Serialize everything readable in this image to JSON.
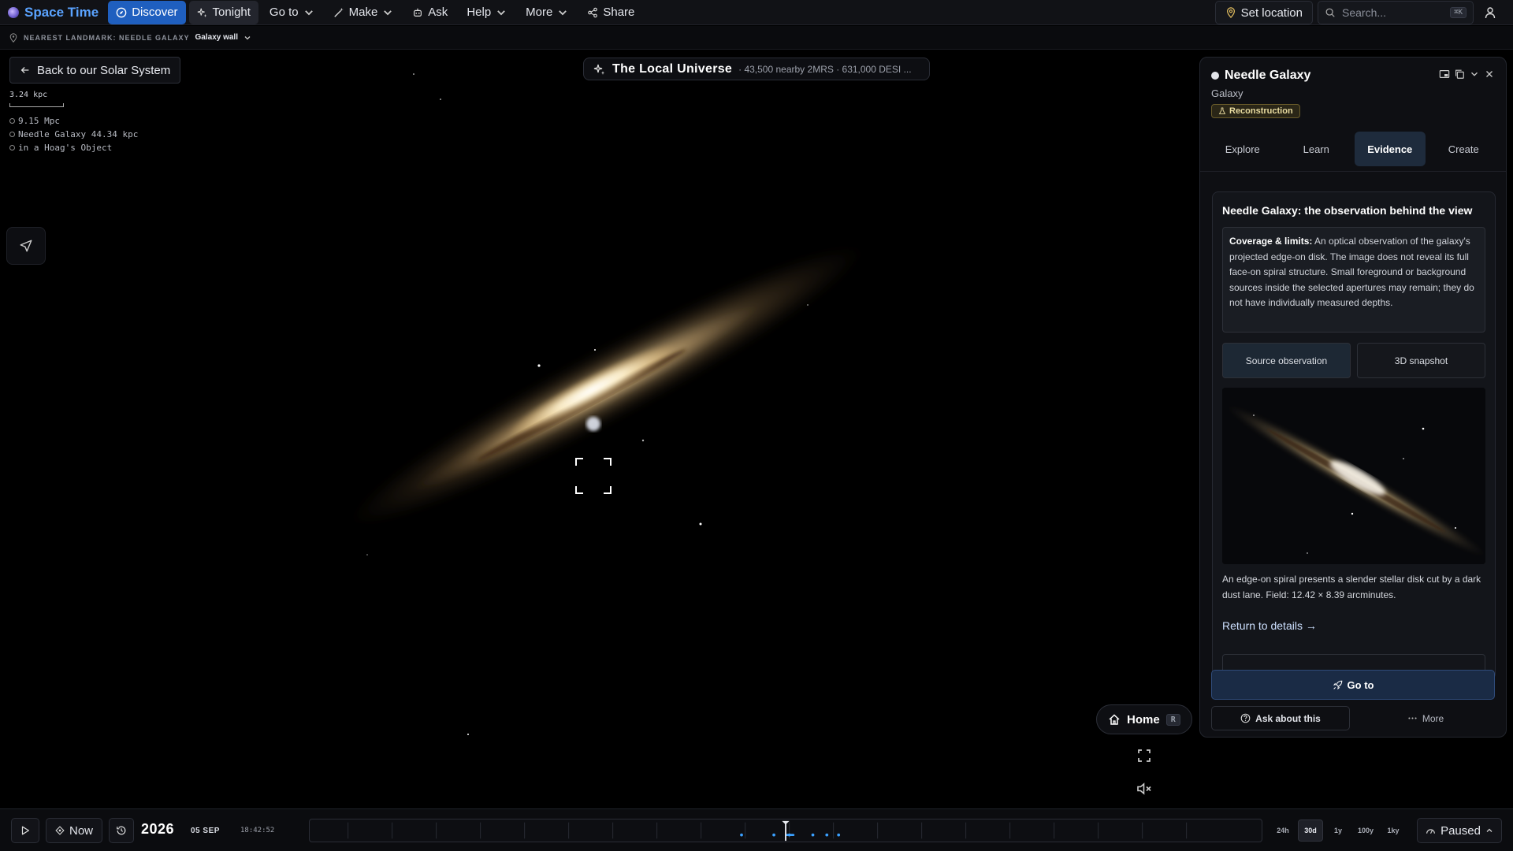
{
  "app": {
    "name": "Space Time"
  },
  "nav": {
    "discover": "Discover",
    "tonight": "Tonight",
    "goto": "Go to",
    "make": "Make",
    "ask": "Ask",
    "help": "Help",
    "more": "More",
    "share": "Share"
  },
  "top_right": {
    "set_location": "Set location",
    "search_placeholder": "Search...",
    "search_shortcut": "⌘K"
  },
  "subbar": {
    "landmark_label": "NEAREST LANDMARK: NEEDLE GALAXY",
    "landmark_value": "Galaxy wall"
  },
  "overlay": {
    "back_label": "Back to our Solar System",
    "scale_label": "3.24 kpc",
    "distances": [
      "9.15 Mpc",
      "Needle Galaxy 44.34 kpc",
      "in a Hoag's Object"
    ]
  },
  "universe": {
    "title": "The Local Universe",
    "subtitle": "· 43,500 nearby 2MRS · 631,000 DESI ..."
  },
  "controls": {
    "home_label": "Home",
    "home_key": "R"
  },
  "panel": {
    "title": "Needle Galaxy",
    "type": "Galaxy",
    "badge": "Reconstruction",
    "tabs": [
      "Explore",
      "Learn",
      "Evidence",
      "Create"
    ],
    "active_tab": "Evidence",
    "evidence": {
      "heading": "Needle Galaxy: the observation behind the view",
      "limits_label": "Coverage & limits:",
      "limits_text": " An optical observation of the galaxy's projected edge-on disk. The image does not reveal its full face-on spiral structure. Small foreground or background sources inside the selected apertures may remain; they do not have individually measured depths.",
      "toggle_source": "Source observation",
      "toggle_3d": "3D snapshot",
      "caption": "An edge-on spiral presents a slender stellar disk cut by a dark dust lane. Field: 12.42 × 8.39 arcminutes.",
      "return_link": "Return to details →"
    },
    "goto_label": "Go to",
    "ask_label": "Ask about this",
    "more_label": "More"
  },
  "bottom": {
    "now_label": "Now",
    "year": "2026",
    "date": "05 SEP",
    "time": "18:42:52",
    "ranges": [
      "24h",
      "30d",
      "1y",
      "100y",
      "1ky"
    ],
    "active_range": "30d",
    "status": "Paused"
  }
}
